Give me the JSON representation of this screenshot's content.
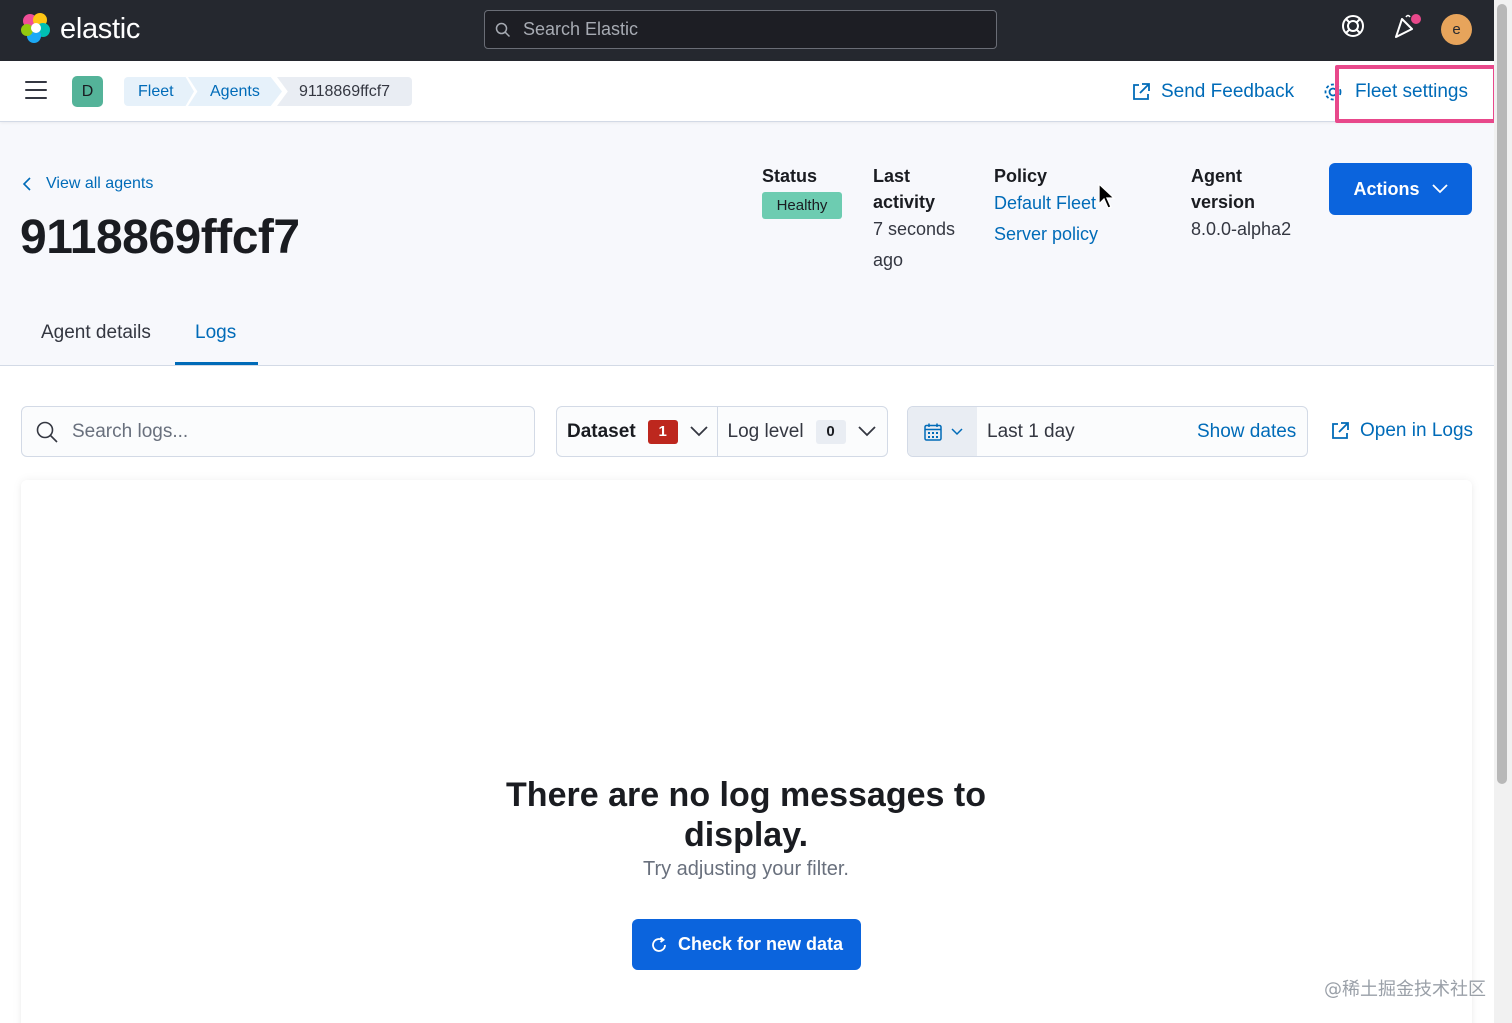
{
  "header": {
    "logo_text": "elastic",
    "search_placeholder": "Search Elastic",
    "user_initial": "e",
    "colors": {
      "background": "#25282f",
      "avatar": "#e7a45b",
      "notification_dot": "#e8488b"
    }
  },
  "subheader": {
    "space_initial": "D",
    "breadcrumbs": [
      "Fleet",
      "Agents",
      "9118869ffcf7"
    ],
    "send_feedback_label": "Send Feedback",
    "fleet_settings_label": "Fleet settings"
  },
  "agent": {
    "back_link_label": "View all agents",
    "title": "9118869ffcf7",
    "status_label": "Status",
    "status_value": "Healthy",
    "last_activity_label_line1": "Last",
    "last_activity_label_line2": "activity",
    "last_activity_value_line1": "7 seconds",
    "last_activity_value_line2": "ago",
    "policy_label": "Policy",
    "policy_link_line1": "Default Fleet",
    "policy_link_line2": "Server policy",
    "version_label_line1": "Agent",
    "version_label_line2": "version",
    "version_value": "8.0.0-alpha2",
    "actions_label": "Actions"
  },
  "tabs": [
    {
      "label": "Agent details",
      "active": false
    },
    {
      "label": "Logs",
      "active": true
    }
  ],
  "logs": {
    "search_placeholder": "Search logs...",
    "dataset_label": "Dataset",
    "dataset_count": "1",
    "log_level_label": "Log level",
    "log_level_count": "0",
    "date_range": "Last 1 day",
    "show_dates_label": "Show dates",
    "open_in_logs_label": "Open in Logs",
    "empty_title": "There are no log messages to display.",
    "empty_body": "Try adjusting your filter.",
    "check_button_label": "Check for new data"
  },
  "watermark": "@稀土掘金技术社区",
  "colors": {
    "primary": "#0b64dd",
    "link": "#006bb8",
    "healthy": "#6dccb1",
    "highlight": "#e8488b"
  }
}
